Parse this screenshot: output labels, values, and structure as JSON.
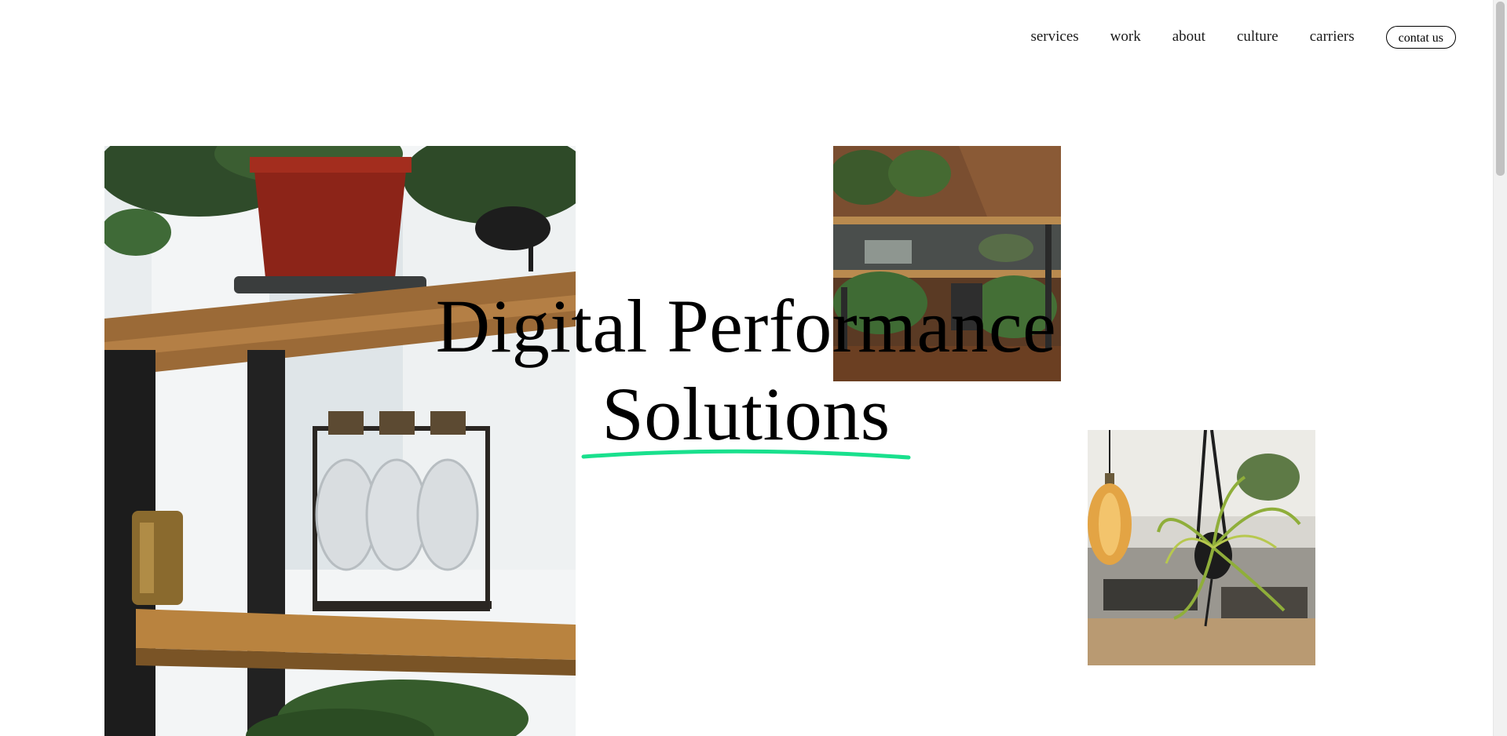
{
  "nav": {
    "items": [
      {
        "label": "services"
      },
      {
        "label": "work"
      },
      {
        "label": "about"
      },
      {
        "label": "culture"
      },
      {
        "label": "carriers"
      }
    ],
    "contact_label": "contat us"
  },
  "hero": {
    "line1": "Digital Performance",
    "line2": "Solutions",
    "accent_color": "#19e08d"
  },
  "images": [
    {
      "name": "shelf-plants-photo"
    },
    {
      "name": "office-shelves-photo"
    },
    {
      "name": "hanging-plant-bulb-photo"
    }
  ]
}
